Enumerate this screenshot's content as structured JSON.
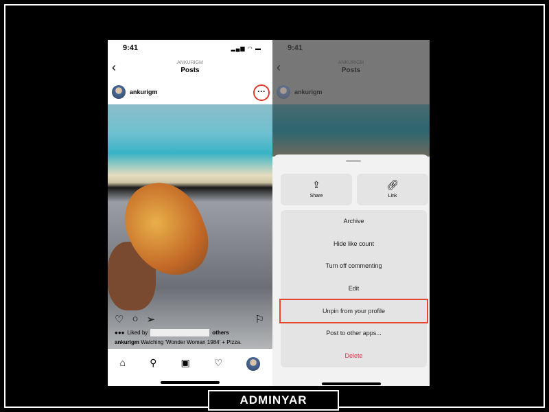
{
  "left_phone": {
    "time": "9:41",
    "header_sub": "ANKURIGM",
    "header_title": "Posts",
    "username": "ankurigm",
    "liked_by": "Liked by",
    "others": "others",
    "caption_user": "ankurigm",
    "caption_text": "Watching 'Wonder Woman 1984' + Pizza."
  },
  "right_phone": {
    "time": "9:41",
    "header_sub": "ANKURIGM",
    "header_title": "Posts",
    "username": "ankurigm",
    "share": "Share",
    "link": "Link",
    "menu": [
      "Archive",
      "Hide like count",
      "Turn off commenting",
      "Edit",
      "Unpin from your profile",
      "Post to other apps...",
      "Delete"
    ]
  },
  "highlight_color": "#e5462e",
  "delete_color": "#e0304a",
  "watermark": "ADMINYAR"
}
